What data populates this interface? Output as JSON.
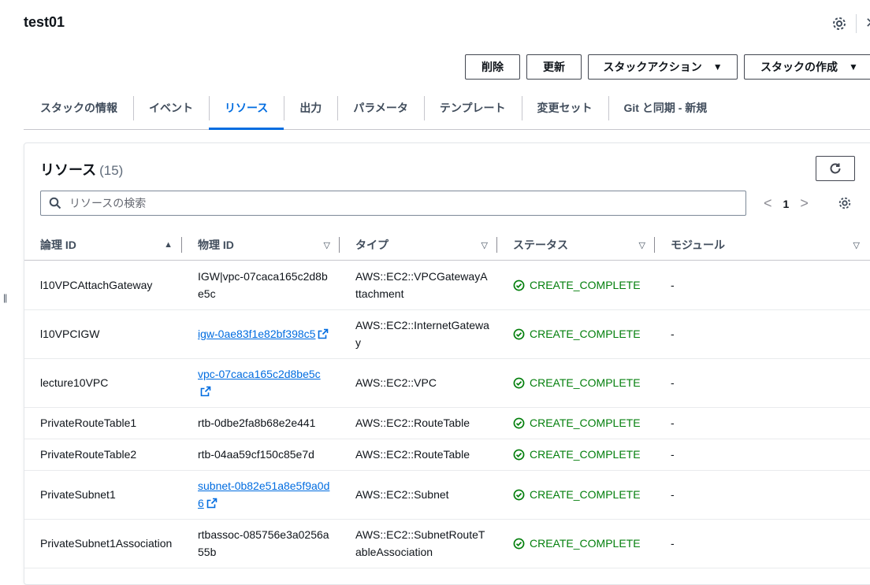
{
  "header": {
    "title": "test01",
    "icons": {
      "settings": "gear-icon",
      "close": "close-icon"
    }
  },
  "actions": {
    "delete": "削除",
    "update": "更新",
    "stack_actions": "スタックアクション",
    "create_stack": "スタックの作成"
  },
  "tabs": [
    {
      "label": "スタックの情報"
    },
    {
      "label": "イベント"
    },
    {
      "label": "リソース",
      "active": true
    },
    {
      "label": "出力"
    },
    {
      "label": "パラメータ"
    },
    {
      "label": "テンプレート"
    },
    {
      "label": "変更セット"
    },
    {
      "label": "Git と同期 - 新規"
    }
  ],
  "resources": {
    "title": "リソース",
    "count": "(15)",
    "search_placeholder": "リソースの検索",
    "page": "1",
    "columns": {
      "logical_id": "論理 ID",
      "physical_id": "物理 ID",
      "type": "タイプ",
      "status": "ステータス",
      "module": "モジュール"
    },
    "rows": [
      {
        "logical_id": "l10VPCAttachGateway",
        "physical_id": "IGW|vpc-07caca165c2d8be5c",
        "physical_link": false,
        "type": "AWS::EC2::VPCGatewayAttachment",
        "status": "CREATE_COMPLETE",
        "module": "-"
      },
      {
        "logical_id": "l10VPCIGW",
        "physical_id": "igw-0ae83f1e82bf398c5",
        "physical_link": true,
        "type": "AWS::EC2::InternetGateway",
        "status": "CREATE_COMPLETE",
        "module": "-"
      },
      {
        "logical_id": "lecture10VPC",
        "physical_id": "vpc-07caca165c2d8be5c",
        "physical_link": true,
        "type": "AWS::EC2::VPC",
        "status": "CREATE_COMPLETE",
        "module": "-"
      },
      {
        "logical_id": "PrivateRouteTable1",
        "physical_id": "rtb-0dbe2fa8b68e2e441",
        "physical_link": false,
        "type": "AWS::EC2::RouteTable",
        "status": "CREATE_COMPLETE",
        "module": "-"
      },
      {
        "logical_id": "PrivateRouteTable2",
        "physical_id": "rtb-04aa59cf150c85e7d",
        "physical_link": false,
        "type": "AWS::EC2::RouteTable",
        "status": "CREATE_COMPLETE",
        "module": "-"
      },
      {
        "logical_id": "PrivateSubnet1",
        "physical_id": "subnet-0b82e51a8e5f9a0d6",
        "physical_link": true,
        "type": "AWS::EC2::Subnet",
        "status": "CREATE_COMPLETE",
        "module": "-"
      },
      {
        "logical_id": "PrivateSubnet1Association",
        "physical_id": "rtbassoc-085756e3a0256a55b",
        "physical_link": false,
        "type": "AWS::EC2::SubnetRouteTableAssociation",
        "status": "CREATE_COMPLETE",
        "module": "-"
      }
    ]
  },
  "colors": {
    "accent": "#006ce0",
    "success": "#037f0c",
    "text": "#0f141a"
  }
}
